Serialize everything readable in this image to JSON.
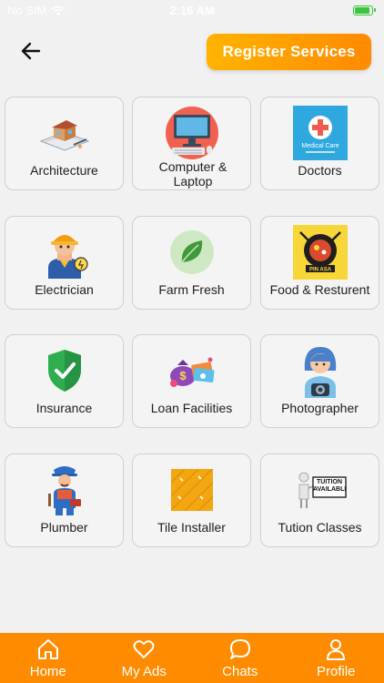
{
  "status_bar": {
    "carrier": "No SIM",
    "time": "2:16 AM"
  },
  "header": {
    "register_label": "Register Services"
  },
  "categories": [
    {
      "label": "Architecture",
      "icon": "architecture-icon"
    },
    {
      "label": "Computer & Laptop",
      "icon": "computer-icon"
    },
    {
      "label": "Doctors",
      "icon": "doctors-icon"
    },
    {
      "label": "Electrician",
      "icon": "electrician-icon"
    },
    {
      "label": "Farm Fresh",
      "icon": "leaf-icon"
    },
    {
      "label": "Food & Resturent",
      "icon": "food-icon"
    },
    {
      "label": "Insurance",
      "icon": "shield-icon"
    },
    {
      "label": "Loan Facilities",
      "icon": "money-bag-icon"
    },
    {
      "label": "Photographer",
      "icon": "photographer-icon"
    },
    {
      "label": "Plumber",
      "icon": "plumber-icon"
    },
    {
      "label": "Tile Installer",
      "icon": "tile-icon"
    },
    {
      "label": "Tution Classes",
      "icon": "tuition-icon"
    }
  ],
  "nav": [
    {
      "label": "Home",
      "icon": "home-icon"
    },
    {
      "label": "My Ads",
      "icon": "heart-icon"
    },
    {
      "label": "Chats",
      "icon": "chat-icon"
    },
    {
      "label": "Profile",
      "icon": "profile-icon"
    }
  ],
  "icon_text": {
    "doctors": "Medical Care",
    "food": "PIN ASA",
    "tuition": "TUITION AVAILABLE"
  },
  "colors": {
    "accent": "#ff8c00",
    "accent_light": "#ffb300",
    "background": "#f1f1f1"
  }
}
